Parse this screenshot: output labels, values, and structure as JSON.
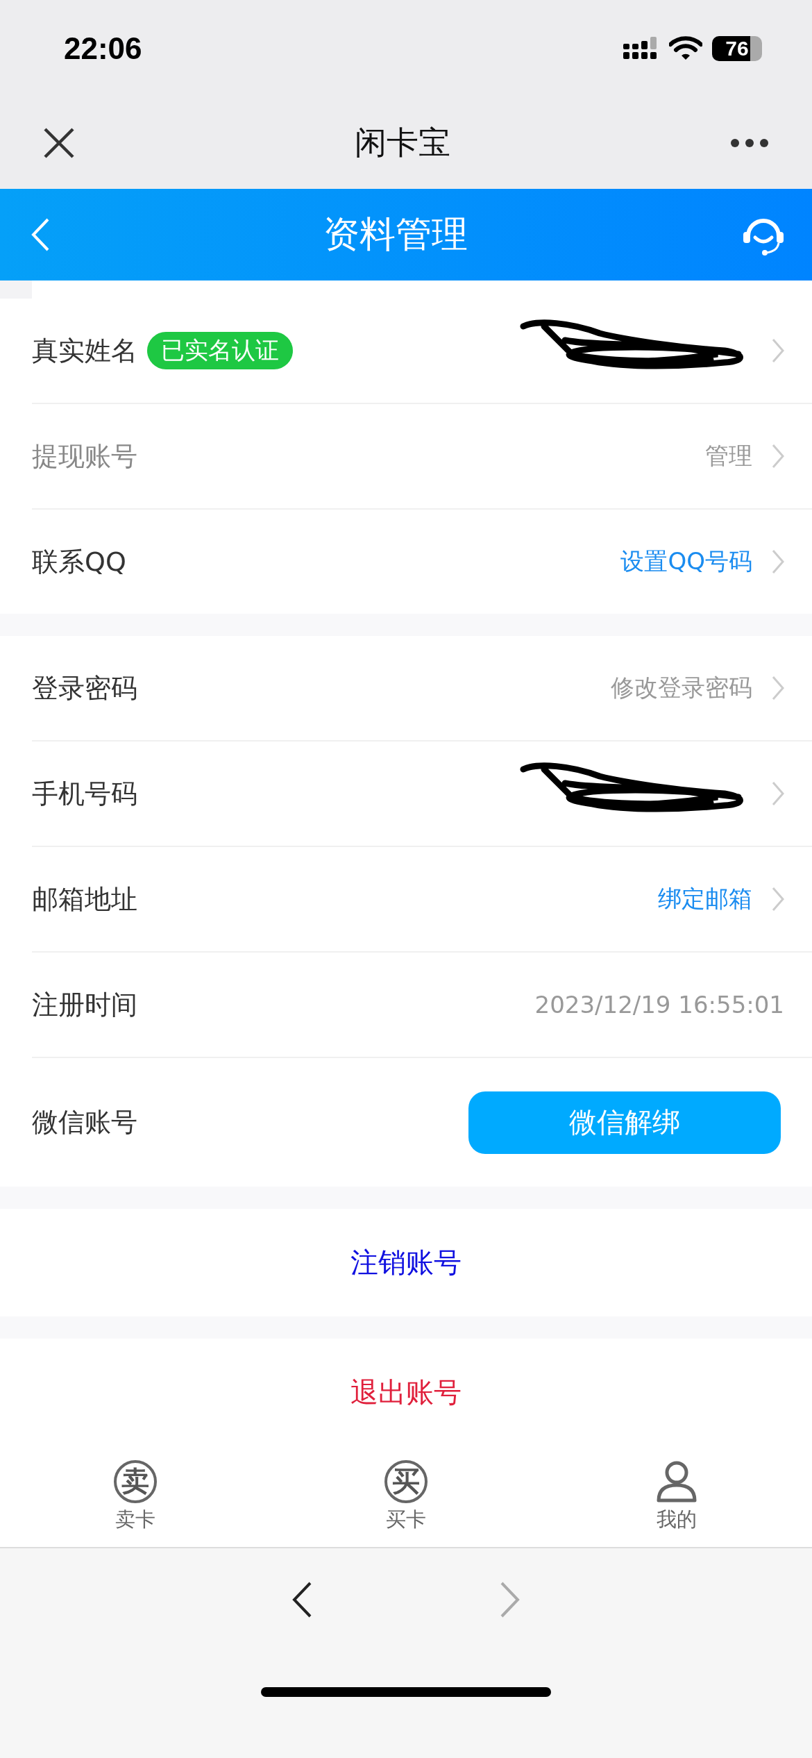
{
  "status_bar": {
    "time": "22:06",
    "battery": "76"
  },
  "browser_nav": {
    "title": "闲卡宝"
  },
  "header": {
    "title": "资料管理"
  },
  "sections": [
    {
      "rows": [
        {
          "label": "真实姓名",
          "badge": "已实名认证",
          "kind": "redacted",
          "chevron": true,
          "disabled": false
        },
        {
          "label": "提现账号",
          "value": "管理",
          "kind": "muted",
          "chevron": true,
          "disabled": true
        },
        {
          "label": "联系QQ",
          "value": "设置QQ号码",
          "kind": "link",
          "chevron": true,
          "disabled": false
        }
      ]
    },
    {
      "rows": [
        {
          "label": "登录密码",
          "value": "修改登录密码",
          "kind": "muted",
          "chevron": true,
          "disabled": false
        },
        {
          "label": "手机号码",
          "kind": "redacted",
          "chevron": true,
          "disabled": false
        },
        {
          "label": "邮箱地址",
          "value": "绑定邮箱",
          "kind": "link",
          "chevron": true,
          "disabled": false
        },
        {
          "label": "注册时间",
          "value": "2023/12/19 16:55:01",
          "kind": "muted",
          "chevron": false,
          "disabled": false
        },
        {
          "label": "微信账号",
          "value": "微信解绑",
          "kind": "button",
          "chevron": false,
          "disabled": false
        }
      ]
    }
  ],
  "actions": [
    {
      "label": "注销账号",
      "kind": "link"
    },
    {
      "label": "退出账号",
      "kind": "danger"
    }
  ],
  "tabs": [
    {
      "label": "卖卡",
      "glyph": "卖",
      "kind": "glyph",
      "selected": false
    },
    {
      "label": "买卡",
      "glyph": "买",
      "kind": "glyph",
      "selected": false
    },
    {
      "label": "我的",
      "kind": "person",
      "selected": false
    }
  ]
}
